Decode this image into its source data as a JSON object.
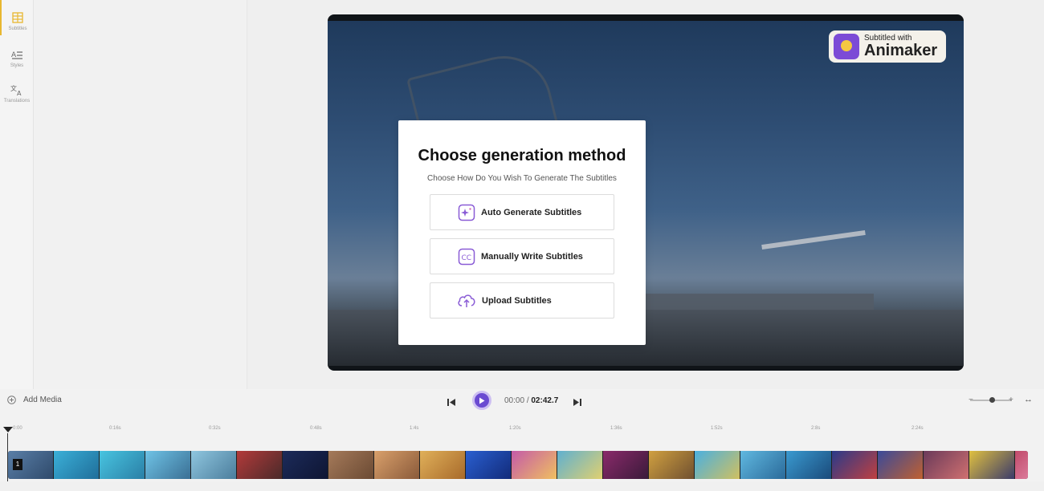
{
  "sidebar": {
    "items": [
      {
        "label": "Subtitles",
        "icon": "subtitles-grid-icon",
        "active": true
      },
      {
        "label": "Styles",
        "icon": "text-style-icon",
        "active": false
      },
      {
        "label": "Translations",
        "icon": "translate-icon",
        "active": false
      }
    ]
  },
  "watermark": {
    "small": "Subtitled with",
    "big": "Animaker"
  },
  "modal": {
    "title": "Choose generation method",
    "subtitle": "Choose How Do You Wish To Generate The Subtitles",
    "options": [
      {
        "label": "Auto Generate Subtitles",
        "icon": "sparkle-icon"
      },
      {
        "label": "Manually Write Subtitles",
        "icon": "cc-icon"
      },
      {
        "label": "Upload Subtitles",
        "icon": "cloud-upload-icon"
      }
    ]
  },
  "controls": {
    "add_media_label": "Add Media",
    "current_time": "00:00",
    "separator": "/",
    "total_time": "02:42.7"
  },
  "timeline": {
    "ticks": [
      "0:00",
      "0:16s",
      "0:32s",
      "0:48s",
      "1:4s",
      "1:20s",
      "1:36s",
      "1:52s",
      "2:8s",
      "2:24s"
    ],
    "clip_number": "1"
  },
  "colors": {
    "accent": "#6a4ad1",
    "active_marker": "#e8b730",
    "icon_purple": "#8a5cd6"
  }
}
